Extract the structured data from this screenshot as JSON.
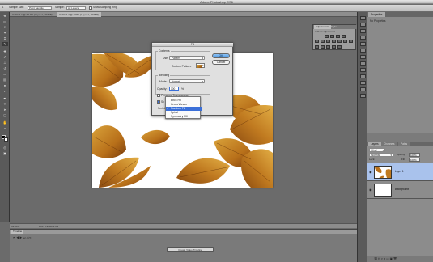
{
  "app": {
    "title": "Adobe Photoshop CS6"
  },
  "options_bar": {
    "sample_size_label": "Sample Size:",
    "sample_size_value": "Point Sample",
    "sample_label": "Sample:",
    "sample_value": "All Layers",
    "show_sampling_ring": "Show Sampling Ring"
  },
  "document_tabs": [
    {
      "label": "Untitled-1 @ 33.3% (Layer 1, RGB/8)"
    },
    {
      "label": "Untitled-2 @ 100% (Layer 1, RGB/8)"
    }
  ],
  "status": {
    "zoom": "33.33%",
    "doc_size": "Doc: 5.93M/11.9M"
  },
  "timeline": {
    "tab": "Timeline",
    "create_button": "Create Video Timeline"
  },
  "adjustments": {
    "tab_adjustments": "Adjustments",
    "tab_styles": "Styles",
    "add_label": "Add an adjustment"
  },
  "properties": {
    "tab": "Properties",
    "text": "No Properties"
  },
  "layers": {
    "tabs": [
      "Layers",
      "Channels",
      "Paths"
    ],
    "kind_value": "Kind",
    "blend_value": "Normal",
    "opacity_label": "Opacity:",
    "opacity_value": "100%",
    "lock_label": "Lock:",
    "fill_label": "Fill:",
    "fill_value": "100%",
    "rows": [
      {
        "name": "Layer 1"
      },
      {
        "name": "Background"
      }
    ]
  },
  "fill_dialog": {
    "title": "Fill",
    "contents_group": "Contents",
    "use_label": "Use:",
    "use_value": "Pattern",
    "custom_pattern_label": "Custom Pattern:",
    "blending_group": "Blending",
    "mode_label": "Mode:",
    "mode_value": "Normal",
    "opacity_label": "Opacity:",
    "opacity_value": "100",
    "opacity_unit": "%",
    "preserve_transparency": "Preserve Transparency",
    "scripted_patterns_short": "Sc",
    "script_label": "Script:",
    "ok": "OK",
    "cancel": "Cancel"
  },
  "pattern_menu": {
    "items": [
      "Brick Fill",
      "Cross Weave",
      "Random Fill",
      "Spiral",
      "Symmetry Fill"
    ],
    "selected_index": 2
  },
  "colors": {
    "leaf_orange": "#b8701a",
    "leaf_dark": "#8a4a10",
    "leaf_yellow": "#d9a23a",
    "selection_blue": "#3a6fd8"
  },
  "icons": {
    "tools": [
      "move-icon",
      "marquee-icon",
      "lasso-icon",
      "quick-select-icon",
      "crop-icon",
      "eyedropper-icon",
      "healing-icon",
      "brush-icon",
      "clone-stamp-icon",
      "history-brush-icon",
      "eraser-icon",
      "gradient-icon",
      "blur-icon",
      "dodge-icon",
      "pen-icon",
      "type-icon",
      "path-select-icon",
      "shape-icon",
      "hand-icon",
      "zoom-icon"
    ]
  }
}
